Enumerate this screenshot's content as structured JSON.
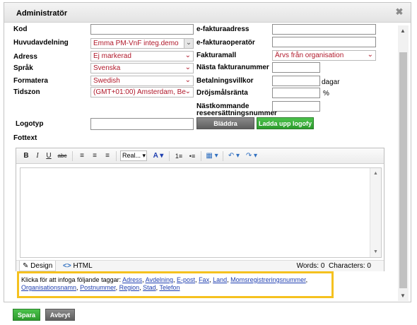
{
  "dialog": {
    "title": "Administratör",
    "close": "✖"
  },
  "left_fields": [
    {
      "label": "Kod",
      "value": ""
    },
    {
      "label": "Huvudavdelning",
      "value": "Emma PM-VnF integ.demo"
    },
    {
      "label": "Adress",
      "value": "Ej markerad"
    },
    {
      "label": "Språk",
      "value": "Svenska"
    },
    {
      "label": "Formatera",
      "value": "Swedish"
    },
    {
      "label": "Tidszon",
      "value": "(GMT+01:00) Amsterdam, Be"
    }
  ],
  "right_fields": [
    {
      "label": "e-fakturaadress",
      "value": ""
    },
    {
      "label": "e-fakturaoperatör",
      "value": ""
    },
    {
      "label": "Fakturamall",
      "value": "Ärvs från organisation"
    },
    {
      "label": "Nästa fakturanummer",
      "value": ""
    },
    {
      "label": "Betalningsvillkor",
      "value": "",
      "unit": "dagar"
    },
    {
      "label": "Dröjsmålsränta",
      "value": "",
      "unit": "%"
    },
    {
      "label_line1": "Nästkommande",
      "label_line2": "reseersättningsnummer",
      "value": ""
    }
  ],
  "logo": {
    "label": "Logotyp",
    "value": "",
    "browse_button": "Bläddra",
    "upload_button": "Ladda upp logofy"
  },
  "footer_text": {
    "label": "Fottext",
    "toolbar": {
      "bold": "B",
      "italic": "I",
      "underline": "U",
      "strike": "abc",
      "align_left": "≡",
      "align_center": "≡",
      "align_right": "≡",
      "font": "Real...",
      "font_color": "A",
      "ordered_list": "1≡",
      "unordered_list": "•≡",
      "table": "▦",
      "undo": "↶",
      "redo": "↷"
    },
    "modes": {
      "design": "Design",
      "html": "HTML"
    },
    "words_label": "Words: 0",
    "chars_label": "Characters: 0"
  },
  "tags": {
    "intro": "Klicka för att infoga följande taggar:",
    "items": [
      "Adress",
      "Avdelning",
      "E-post",
      "Fax",
      "Land",
      "Momsregistreringsnummer",
      "Organisationsnamn",
      "Postnummer",
      "Region",
      "Stad",
      "Telefon"
    ]
  },
  "actions": {
    "save": "Spara",
    "cancel": "Avbryt"
  },
  "colors": {
    "accent_yellow": "#f5c11f",
    "select_text": "#b0182a",
    "green": "#2c9b2c",
    "link": "#1f3fb0"
  }
}
